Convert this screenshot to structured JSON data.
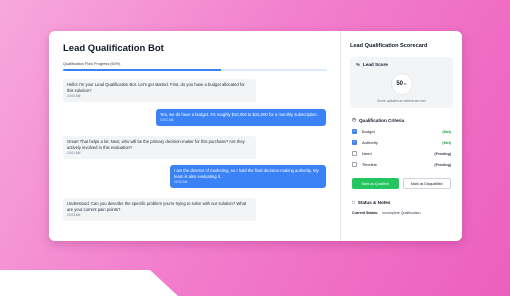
{
  "chat": {
    "title": "Lead Qualification Bot",
    "progress_label": "Qualification Flow Progress (60%)",
    "progress_value": 0.6,
    "messages": [
      {
        "role": "bot",
        "text": "Hello! I'm your Lead Qualification Bot. Let's get started. First, do you have a budget allocated for this solution?",
        "time": "10:00 AM"
      },
      {
        "role": "user",
        "text": "Yes, we do have a budget. It's roughly $10,000 to $15,000 for a monthly subscription.",
        "time": "10:01 AM"
      },
      {
        "role": "bot",
        "text": "Great! That helps a lot. Next, who will be the primary decision-maker for this purchase? Are they actively involved in this evaluation?",
        "time": "10:01 AM"
      },
      {
        "role": "user",
        "text": "I am the director of marketing, so I hold the final decision-making authority. My team is also evaluating it.",
        "time": "10:02 AM"
      },
      {
        "role": "bot",
        "text": "Understood. Can you describe the specific problem you're trying to solve with our solution? What are your current pain points?",
        "time": "10:03 AM"
      }
    ]
  },
  "scorecard": {
    "title": "Lead Qualification Scorecard",
    "lead_score": {
      "heading": "Lead Score",
      "value": "50",
      "unit": "%",
      "note": "Score updates as criteria are met"
    },
    "criteria": {
      "heading": "Qualification Criteria",
      "items": [
        {
          "label": "Budget",
          "status": "(Met)",
          "met": true
        },
        {
          "label": "Authority",
          "status": "(Met)",
          "met": true
        },
        {
          "label": "Need",
          "status": "(Pending)",
          "met": false
        },
        {
          "label": "Timeline",
          "status": "(Pending)",
          "met": false
        }
      ]
    },
    "buttons": {
      "qualified": "Mark as Qualified",
      "disqualified": "Mark as Disqualified"
    },
    "status": {
      "heading": "Status & Notes",
      "current_label": "Current Status:",
      "current_value": "Incomplete Qualification"
    }
  },
  "colors": {
    "accent": "#3b82f6",
    "success": "#22c55e",
    "background": "#f27fcd"
  },
  "icons": {
    "lead_score": "percent-icon",
    "criteria": "clock-icon",
    "status": "note-icon"
  }
}
